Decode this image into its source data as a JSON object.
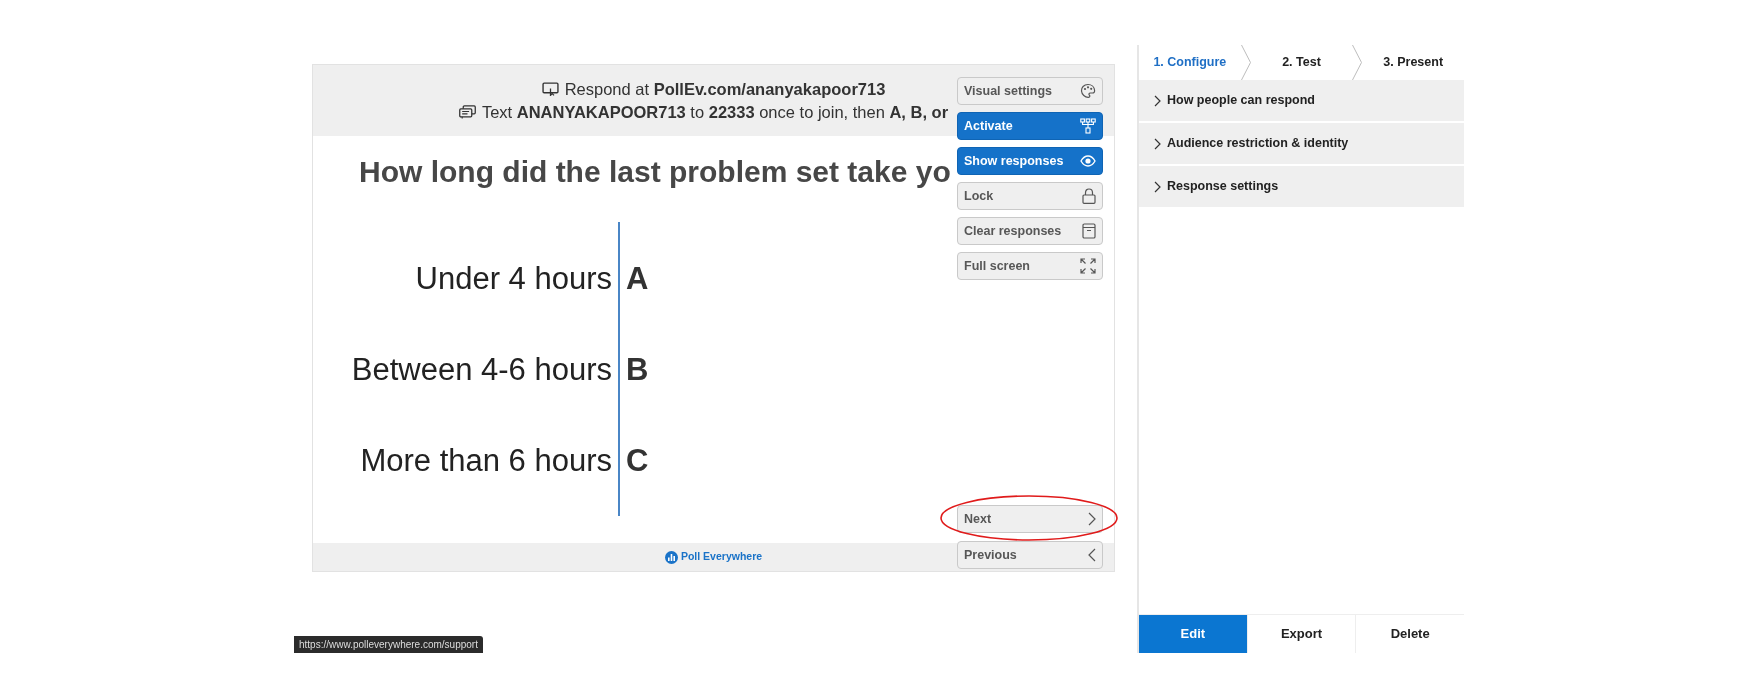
{
  "slide": {
    "join_instructions": [
      {
        "kind": "web",
        "text": "Respond at **PollEv.com/ananyakapoor713**"
      },
      {
        "kind": "sms",
        "text": "Text **ANANYAKAPOOR713** to **22333** once to join, then **A, B, or**"
      }
    ],
    "question": "How long did the last problem set take yo",
    "options": [
      {
        "label": "Under 4 hours",
        "letter": "A"
      },
      {
        "label": "Between 4-6 hours",
        "letter": "B"
      },
      {
        "label": "More than 6 hours",
        "letter": "C"
      }
    ],
    "footer_logo": "Poll Everywhere"
  },
  "controls": [
    {
      "kind": "visual",
      "label": "Visual settings",
      "on": false
    },
    {
      "kind": "activate",
      "label": "Activate",
      "on": true
    },
    {
      "kind": "responses",
      "label": "Show responses",
      "on": true
    },
    {
      "kind": "lock",
      "label": "Lock",
      "on": false
    },
    {
      "kind": "clear",
      "label": "Clear responses",
      "on": false
    },
    {
      "kind": "fullscreen",
      "label": "Full screen",
      "on": false
    }
  ],
  "navigation": [
    {
      "kind": "next",
      "label": "Next",
      "circled": true
    },
    {
      "kind": "previous",
      "label": "Previous",
      "circled": false
    }
  ],
  "steps": [
    {
      "label": "1. Configure",
      "selected": true
    },
    {
      "label": "2. Test",
      "selected": false
    },
    {
      "label": "3. Present",
      "selected": false
    }
  ],
  "settings_sections": [
    {
      "label": "How people can respond",
      "expanded": false
    },
    {
      "label": "Audience restriction & identity",
      "expanded": false
    },
    {
      "label": "Response settings",
      "expanded": false
    }
  ],
  "actions": [
    {
      "label": "Edit",
      "selected": true
    },
    {
      "label": "Export",
      "selected": false
    },
    {
      "label": "Delete",
      "selected": false
    }
  ],
  "status_bar": {
    "url": "https://www.polleverywhere.com/support"
  }
}
